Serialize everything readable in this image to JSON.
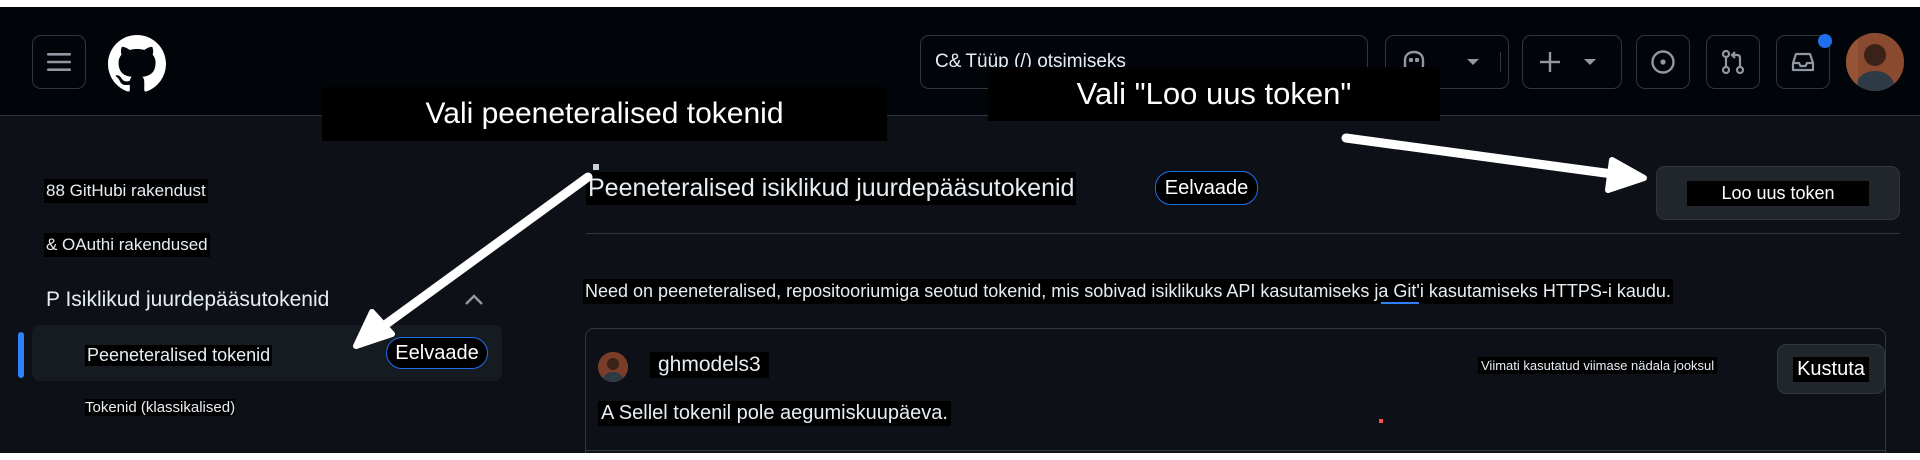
{
  "header": {
    "search_placeholder": "Tüüp (/) otsimiseks",
    "search_prefix": "C&"
  },
  "annotations": {
    "left": "Vali peeneteralised tokenid",
    "right": "Vali \"Loo uus token\""
  },
  "sidebar": {
    "items": [
      {
        "label": "88 GitHubi rakendust"
      },
      {
        "label": "& OAuthi rakendused"
      },
      {
        "label": "P Isiklikud juurdepääsutokenid"
      },
      {
        "label": "Peeneteralised tokenid",
        "badge": "Eelvaade",
        "active": true
      },
      {
        "label": "Tokenid (klassikalised)"
      }
    ]
  },
  "main": {
    "title": "Peeneteralised isiklikud juurdepääsutokenid",
    "title_badge": "Eelvaade",
    "new_token_button": "Loo uus token",
    "description": "Need on peeneteralised, repositooriumiga seotud tokenid, mis sobivad isiklikuks API kasutamiseks ja Git'i kasutamiseks HTTPS-i kaudu.",
    "token": {
      "name": "ghmodels3",
      "last_used": "Viimati kasutatud viimase nädala jooksul",
      "delete_button": "Kustuta",
      "expiry_note": "A Sellel tokenil pole aegumiskuupäeva."
    }
  },
  "colors": {
    "background": "#0d1117",
    "header": "#010409",
    "accent_blue": "#2f81f7",
    "border": "#30363d"
  }
}
